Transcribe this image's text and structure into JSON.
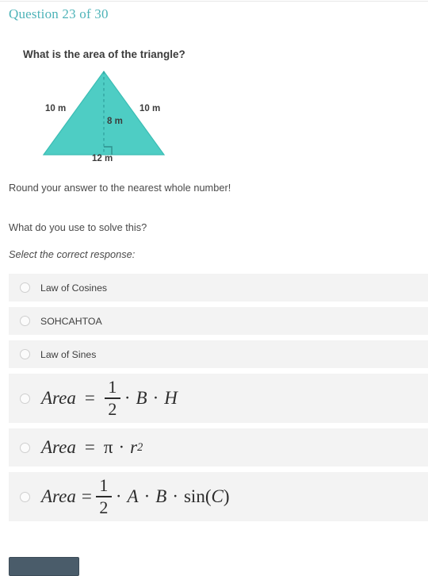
{
  "header": {
    "question_label": "Question 23 of 30",
    "accent_color": "#4db3b8"
  },
  "question": {
    "prompt": "What is the area of the triangle?",
    "instruction": "Round your answer to the nearest whole number!",
    "sub_question": "What do you use to solve this?",
    "select_hint": "Select the correct response:"
  },
  "figure": {
    "shape": "triangle",
    "fill_color": "#4ecdc4",
    "stroke_color": "#3bbdb4",
    "left_side_label": "10 m",
    "right_side_label": "10 m",
    "height_label": "8 m",
    "base_label": "12 m",
    "height_line_style": "dashed",
    "right_angle_marker": true
  },
  "options": [
    {
      "type": "text",
      "label": "Law of Cosines",
      "selected": false
    },
    {
      "type": "text",
      "label": "SOHCAHTOA",
      "selected": false
    },
    {
      "type": "text",
      "label": "Law of Sines",
      "selected": false
    },
    {
      "type": "math",
      "label": "Area = 1/2 · B · H",
      "selected": false
    },
    {
      "type": "math",
      "label": "Area = π · r^2",
      "selected": false
    },
    {
      "type": "math",
      "label": "Area = 1/2 · A · B · sin(C)",
      "selected": false
    }
  ],
  "math": {
    "area_word": "Area",
    "equals": "=",
    "dot": "·",
    "one": "1",
    "two": "2",
    "B": "B",
    "H": "H",
    "A": "A",
    "pi": "π",
    "r": "r",
    "exp_two": "2",
    "sin_open": "sin(",
    "C": "C",
    "close_paren": ")"
  },
  "footer": {
    "button_color": "#4a5c6a"
  }
}
